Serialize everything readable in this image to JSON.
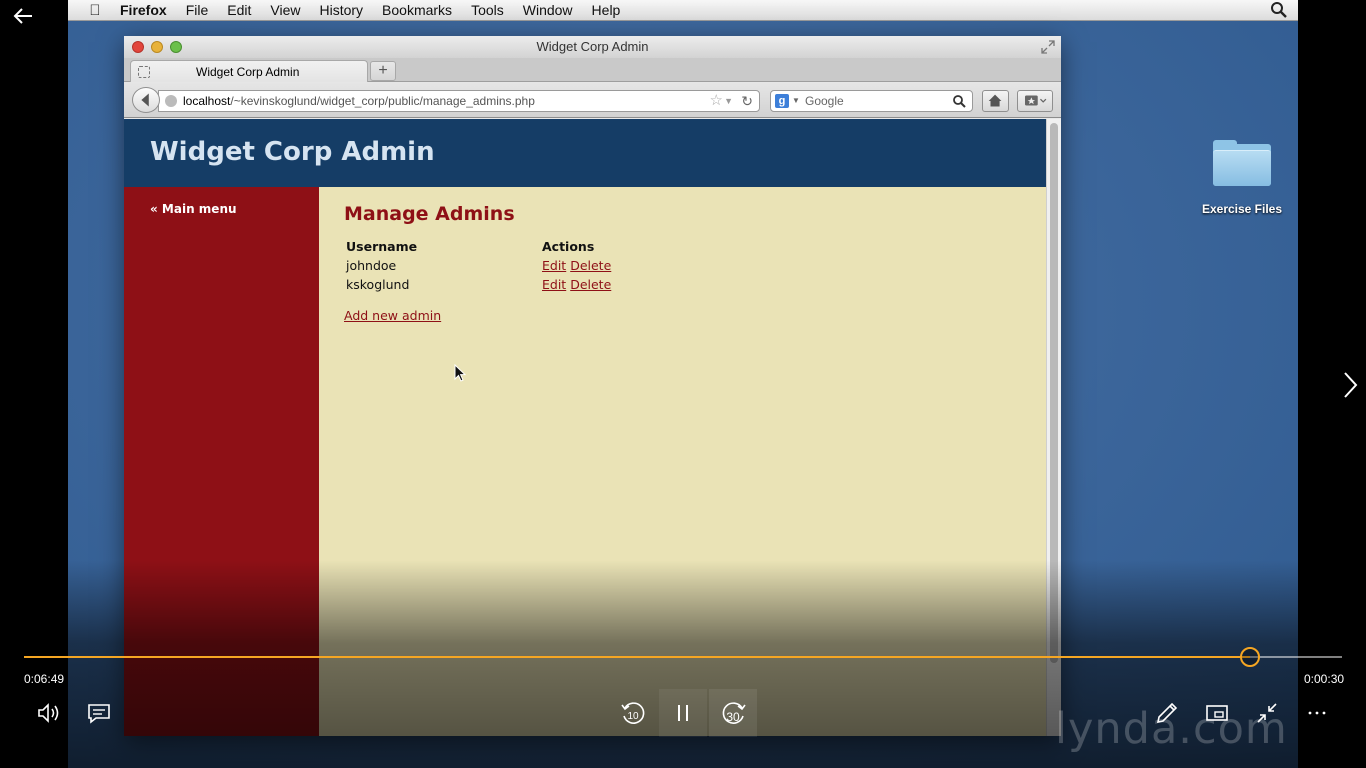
{
  "mac_menubar": {
    "app_name": "Firefox",
    "items": [
      "File",
      "Edit",
      "View",
      "History",
      "Bookmarks",
      "Tools",
      "Window",
      "Help"
    ]
  },
  "desktop": {
    "folder_label": "Exercise Files"
  },
  "browser": {
    "window_title": "Widget Corp Admin",
    "tab_title": "Widget Corp Admin",
    "url_host": "localhost",
    "url_path": "/~kevinskoglund/widget_corp/public/manage_admins.php",
    "search_placeholder": "Google"
  },
  "page": {
    "site_title": "Widget Corp Admin",
    "nav_link": "« Main menu",
    "heading": "Manage Admins",
    "table": {
      "headers": [
        "Username",
        "Actions"
      ],
      "rows": [
        {
          "username": "johndoe",
          "edit": "Edit",
          "delete": "Delete"
        },
        {
          "username": "kskoglund",
          "edit": "Edit",
          "delete": "Delete"
        }
      ]
    },
    "add_link": "Add new admin"
  },
  "player": {
    "elapsed": "0:06:49",
    "remaining": "0:00:30",
    "progress_fraction": 0.93,
    "rewind_label": "10",
    "forward_label": "30",
    "watermark": "lynda.com",
    "accent_color": "#f5a623"
  }
}
